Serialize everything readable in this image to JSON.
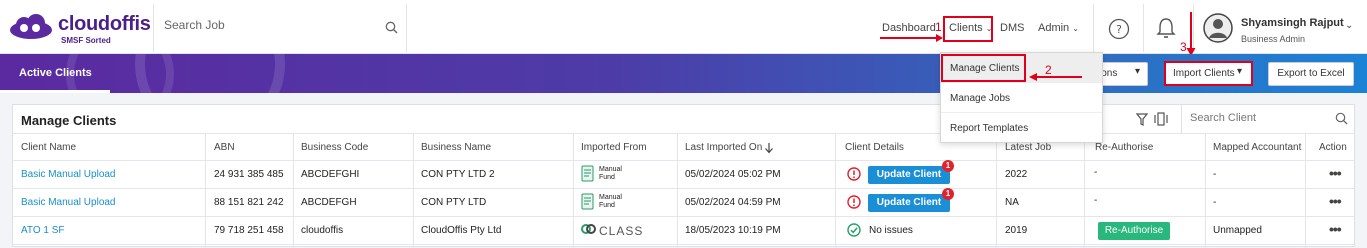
{
  "logo": {
    "brand": "cloudoffis",
    "tagline": "SMSF Sorted"
  },
  "search": {
    "placeholder": "Search Job"
  },
  "nav": {
    "dashboard": "Dashboard",
    "clients": "Clients",
    "dms": "DMS",
    "admin": "Admin"
  },
  "user": {
    "name": "Shyamsingh Rajput",
    "role": "Business Admin"
  },
  "annotations": {
    "step1": "1",
    "step2": "2",
    "step3": "3"
  },
  "banner": {
    "active_tab": "Active Clients",
    "options_label": "ions",
    "import_label": "Import Clients",
    "export_label": "Export to Excel"
  },
  "clients_menu": {
    "items": [
      "Manage Clients",
      "Manage Jobs",
      "Report Templates"
    ],
    "selected": "Manage Clients"
  },
  "panel": {
    "title": "Manage Clients",
    "search_placeholder": "Search Client",
    "columns": [
      "Client Name",
      "ABN",
      "Business Code",
      "Business Name",
      "Imported From",
      "Last Imported On",
      "Client Details",
      "Latest Job",
      "Re-Authorise",
      "Mapped Accountant",
      "Action"
    ],
    "rows": [
      {
        "client_name": "Basic Manual Upload",
        "abn": "24 931 385 485",
        "business_code": "ABCDEFGHI",
        "business_name": "CON PTY LTD 2",
        "imported_from": "Manual Fund",
        "last_imported": "05/02/2024 05:02 PM",
        "details": "Update Client",
        "details_badge": "1",
        "latest_job": "2022",
        "reauth": "-",
        "accountant": "-"
      },
      {
        "client_name": "Basic Manual Upload",
        "abn": "88 151 821 242",
        "business_code": "ABCDEFGH",
        "business_name": "CON PTY LTD",
        "imported_from": "Manual Fund",
        "last_imported": "05/02/2024 04:59 PM",
        "details": "Update Client",
        "details_badge": "1",
        "latest_job": "NA",
        "reauth": "-",
        "accountant": "-"
      },
      {
        "client_name": "ATO 1 SF",
        "abn": "79 718 251 458",
        "business_code": "cloudoffis",
        "business_name": "CloudOffis Pty Ltd",
        "imported_from": "CLASS",
        "last_imported": "18/05/2023 10:19 PM",
        "details": "No issues",
        "latest_job": "2019",
        "reauth": "Re-Authorise",
        "accountant": "Unmapped"
      }
    ]
  },
  "colors": {
    "brand": "#4a1f8a",
    "accent_blue": "#1b8fd6",
    "annotation_red": "#e0001b",
    "success": "#28b77d"
  }
}
